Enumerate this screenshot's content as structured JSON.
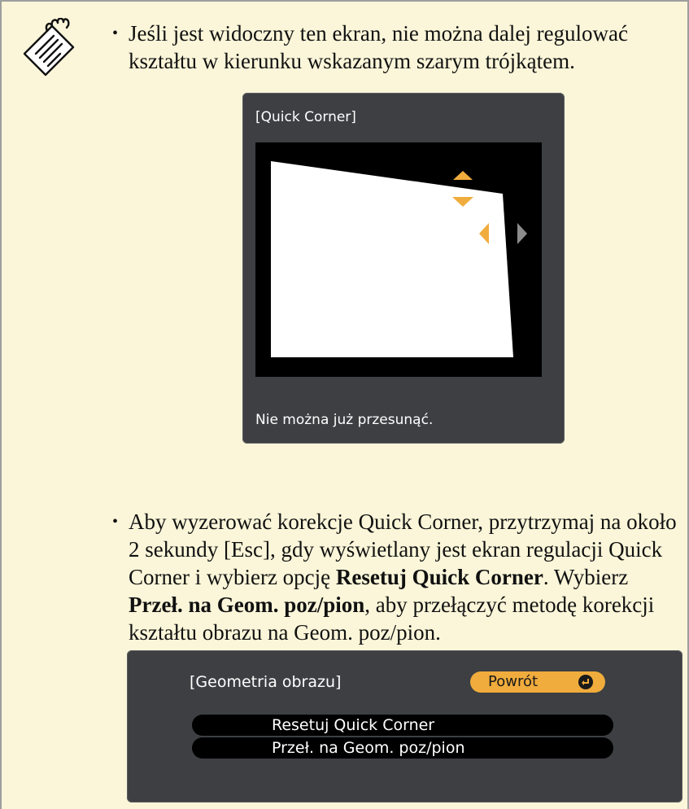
{
  "note": {
    "icon": "note-pencil-icon",
    "bullets": [
      {
        "text": "Jeśli jest widoczny ten ekran, nie można dalej regulować kształtu w kierunku wskazanym szarym trójkątem."
      },
      {
        "part1": "Aby wyzerować korekcje Quick Corner, przytrzymaj na około 2 sekundy [Esc], gdy wyświetlany jest ekran regulacji Quick Corner i wybierz opcję ",
        "bold1": "Resetuj Quick Corner",
        "part2": ". Wybierz ",
        "bold2": "Przeł. na Geom. poz/pion",
        "part3": ", aby przełączyć metodę korekcji kształtu obrazu na Geom. poz/pion."
      }
    ]
  },
  "quick_corner_screen": {
    "title": "[Quick Corner]",
    "message": "Nie można już przesunąć.",
    "colors": {
      "arrow_active": "#f0ac3c",
      "arrow_disabled": "#8c8c8c",
      "panel": "#3d3f42"
    }
  },
  "geometry_screen": {
    "title": "[Geometria obrazu]",
    "back_label": "Powrót",
    "back_icon": "enter-icon",
    "menu_items": [
      {
        "label": "Resetuj Quick Corner"
      },
      {
        "label": "Przeł. na Geom. poz/pion"
      }
    ]
  }
}
